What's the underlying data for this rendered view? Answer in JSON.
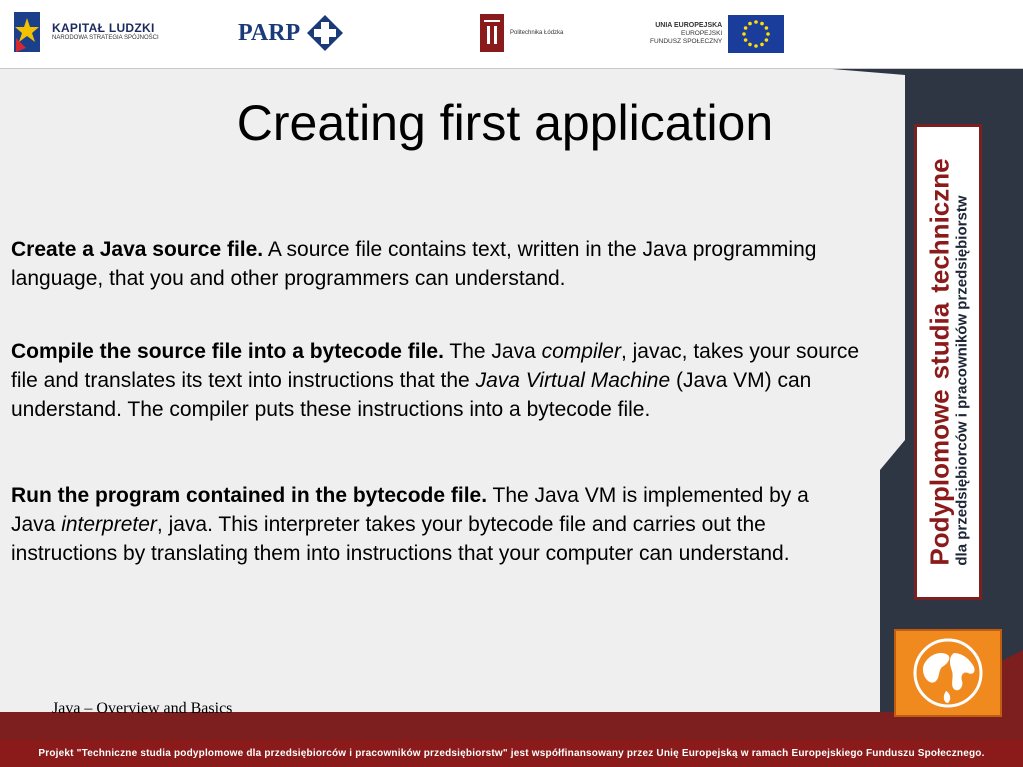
{
  "header": {
    "kapital_title": "KAPITAŁ LUDZKI",
    "kapital_subtitle": "NARODOWA STRATEGIA SPÓJNOŚCI",
    "parp": "PARP",
    "politechnika": "Politechnika Łódzka",
    "ue_line1": "UNIA EUROPEJSKA",
    "ue_line2": "EUROPEJSKI",
    "ue_line3": "FUNDUSZ SPOŁECZNY"
  },
  "slide": {
    "title": "Creating first application",
    "paragraphs": [
      {
        "bold": "Create a Java source file.",
        "text1": " A source file contains text, written in the Java programming language, that you and other programmers can understand."
      },
      {
        "bold": "Compile the source file into a bytecode file.",
        "text1": " The Java ",
        "italic1": "compiler",
        "text2": ", javac, takes your source file and translates its text into instructions that the ",
        "italic2": "Java Virtual Machine",
        "text3": " (Java VM) can understand. The compiler puts these instructions into a bytecode file."
      },
      {
        "bold": "Run the program contained in the bytecode file.",
        "text1": " The Java VM is implemented by a Java ",
        "italic1": "interpreter",
        "text2": ", java. This interpreter takes your bytecode file and carries out the instructions by translating them into instructions that your computer can understand."
      }
    ],
    "footer_note": "Java – Overview and Basics"
  },
  "side": {
    "line1a": "Podyplomowe",
    "line1b": "studia",
    "line1c": "techniczne",
    "line2": "dla przedsiębiorców i pracowników przedsiębiorstw"
  },
  "bottom_bar": "Projekt \"Techniczne studia podyplomowe dla przedsiębiorców i pracowników przedsiębiorstw\" jest współfinansowany przez Unię Europejską w ramach Europejskiego Funduszu Społecznego.",
  "colors": {
    "dark_stripe": "#2e3543",
    "maroon": "#8b1a1a",
    "orange": "#f08a1e",
    "eu_blue": "#1a3c9a",
    "eu_star": "#ffde00"
  }
}
